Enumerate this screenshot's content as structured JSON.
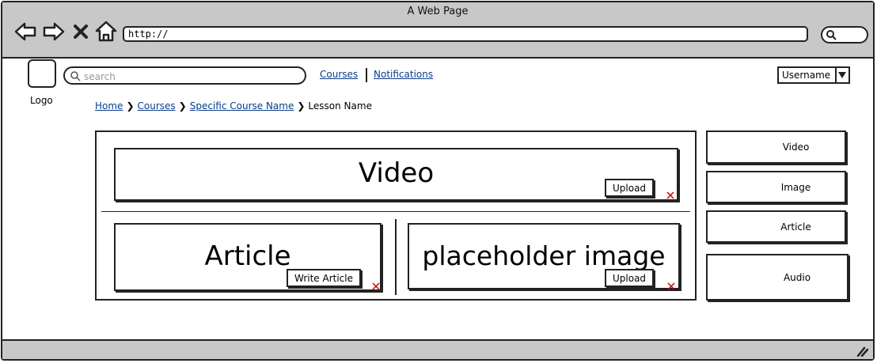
{
  "window": {
    "title": "A Web Page",
    "url": "http://"
  },
  "header": {
    "logo_label": "Logo",
    "search_placeholder": "search",
    "links": [
      "Courses",
      "Notifications"
    ],
    "username": "Username"
  },
  "breadcrumb": [
    "Home",
    "Courses",
    "Specific Course Name",
    "Lesson Name"
  ],
  "editor": {
    "video": {
      "title": "Video",
      "button": "Upload"
    },
    "article": {
      "title": "Article",
      "button": "Write Article"
    },
    "image": {
      "title": "placeholder image",
      "button": "Upload"
    }
  },
  "sidebar": {
    "items": [
      "Video",
      "Image",
      "Article",
      "Audio"
    ]
  },
  "colors": {
    "chrome": "#c8c8c8",
    "link": "#0a3d8a",
    "close": "#cc0000"
  }
}
